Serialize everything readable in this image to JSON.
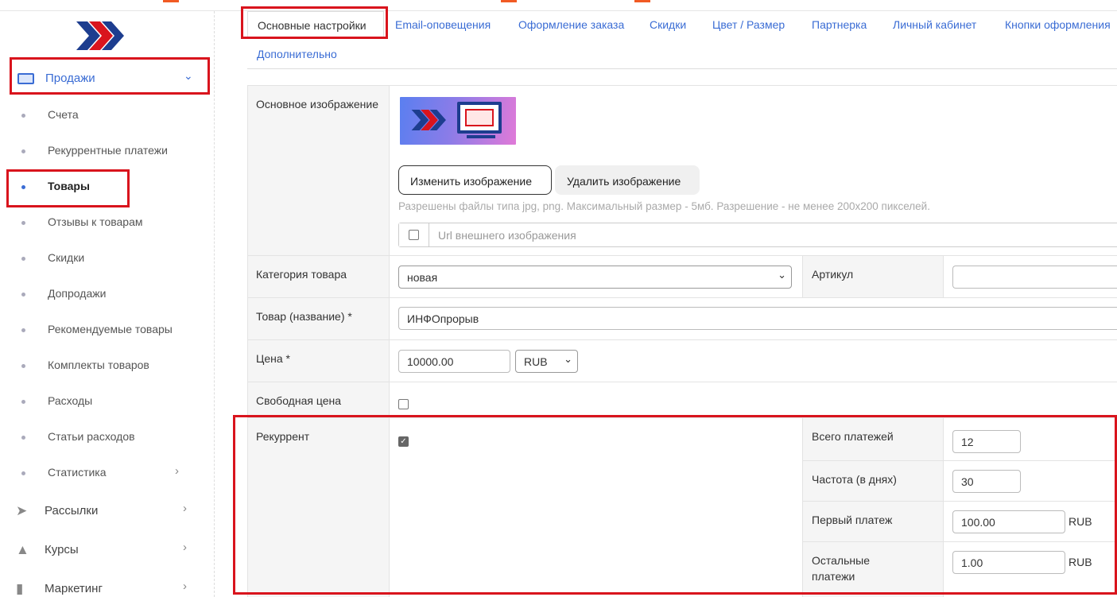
{
  "sidebar": {
    "sales_label": "Продажи",
    "sub_items": [
      {
        "label": "Счета"
      },
      {
        "label": "Рекуррентные платежи"
      },
      {
        "label": "Товары"
      },
      {
        "label": "Отзывы к товарам"
      },
      {
        "label": "Скидки"
      },
      {
        "label": "Допродажи"
      },
      {
        "label": "Рекомендуемые товары"
      },
      {
        "label": "Комплекты товаров"
      },
      {
        "label": "Расходы"
      },
      {
        "label": "Статьи расходов"
      },
      {
        "label": "Статистика"
      }
    ],
    "main_items": [
      {
        "label": "Рассылки",
        "icon": "paper-plane-icon"
      },
      {
        "label": "Курсы",
        "icon": "graduation-cap-icon"
      },
      {
        "label": "Маркетинг",
        "icon": "bar-chart-icon"
      }
    ]
  },
  "tabs": [
    {
      "label": "Основные настройки"
    },
    {
      "label": "Email-оповещения"
    },
    {
      "label": "Оформление заказа"
    },
    {
      "label": "Скидки"
    },
    {
      "label": "Цвет / Размер"
    },
    {
      "label": "Партнерка"
    },
    {
      "label": "Личный кабинет"
    },
    {
      "label": "Кнопки оформления"
    },
    {
      "label": "Дополнительно"
    }
  ],
  "form": {
    "main_image_label": "Основное изображение",
    "change_image_btn": "Изменить изображение",
    "delete_image_btn": "Удалить изображение",
    "image_hint": "Разрешены файлы типа jpg, png. Максимальный размер - 5мб. Разрешение - не менее 200x200 пикселей.",
    "url_placeholder": "Url внешнего изображения",
    "category_label": "Категория товара",
    "category_value": "новая",
    "article_label": "Артикул",
    "article_value": "",
    "name_label": "Товар (название) *",
    "name_value": "ИНФОпрорыв",
    "price_label": "Цена *",
    "price_value": "10000.00",
    "currency_value": "RUB",
    "free_price_label": "Свободная цена",
    "free_price_checked": false,
    "recurrent_label": "Рекуррент",
    "recurrent_checked": true,
    "total_payments_label": "Всего платежей",
    "total_payments_value": "12",
    "frequency_label": "Частота (в днях)",
    "frequency_value": "30",
    "first_payment_label": "Первый платеж",
    "first_payment_value": "100.00",
    "first_payment_unit": "RUB",
    "other_payments_label": "Остальные платежи",
    "other_payments_value": "1.00",
    "other_payments_unit": "RUB"
  },
  "colors": {
    "accent": "#3a6cd4",
    "highlight": "#d9141d"
  }
}
